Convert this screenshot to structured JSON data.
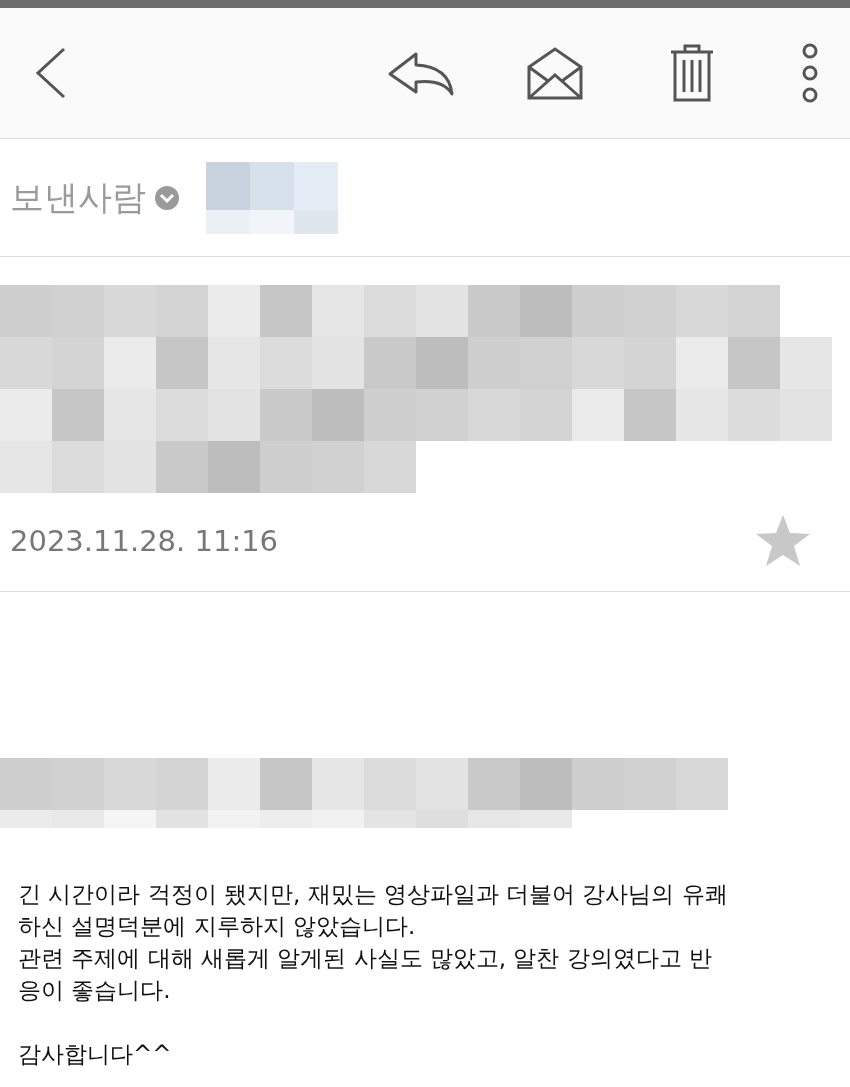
{
  "toolbar": {
    "actions": [
      {
        "kind": "back"
      },
      {
        "kind": "reply"
      },
      {
        "kind": "mark-unread"
      },
      {
        "kind": "delete"
      },
      {
        "kind": "more"
      }
    ]
  },
  "sender": {
    "label": "보낸사람",
    "redacted": true
  },
  "header": {
    "subject_redacted": true,
    "date": "2023.11.28. 11:16",
    "starred": false
  },
  "body": {
    "greeting_redacted": true,
    "paragraphs": [
      [
        "긴 시간이라 걱정이 됐지만, 재밌는 영상파일과 더불어 강사님의 유쾌",
        "하신 설명덕분에 지루하지 않았습니다.",
        "관련 주제에 대해 새롭게 알게된 사실도 많았고, 알찬 강의였다고 반",
        "응이 좋습니다."
      ],
      [
        "감사합니다^^"
      ]
    ]
  }
}
